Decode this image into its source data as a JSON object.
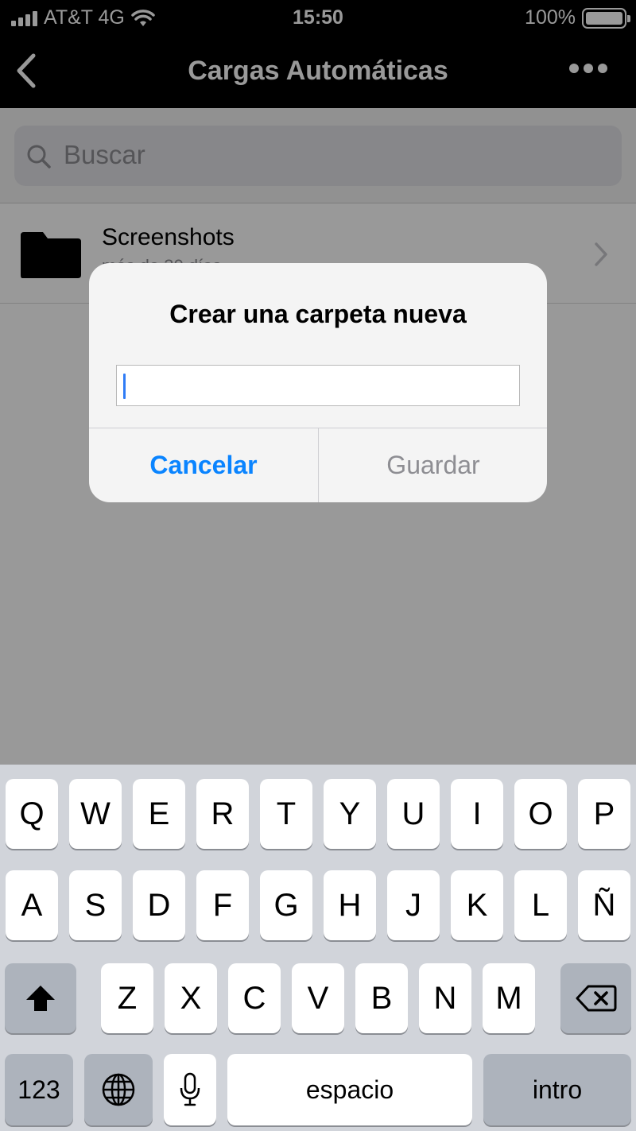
{
  "status_bar": {
    "carrier": "AT&T 4G",
    "time": "15:50",
    "battery": "100%",
    "battery_level": 1.0
  },
  "nav": {
    "title": "Cargas Automáticas",
    "back_icon": "chevron-left-icon",
    "more_icon": "ellipsis-icon"
  },
  "search": {
    "placeholder": "Buscar"
  },
  "list": {
    "items": [
      {
        "name": "Screenshots",
        "subtitle": "más de 30 días"
      }
    ]
  },
  "dialog": {
    "title": "Crear una carpeta nueva",
    "input_value": "",
    "cancel_label": "Cancelar",
    "save_label": "Guardar"
  },
  "keyboard": {
    "row1": [
      "Q",
      "W",
      "E",
      "R",
      "T",
      "Y",
      "U",
      "I",
      "O",
      "P"
    ],
    "row2": [
      "A",
      "S",
      "D",
      "F",
      "G",
      "H",
      "J",
      "K",
      "L",
      "Ñ"
    ],
    "row3": [
      "Z",
      "X",
      "C",
      "V",
      "B",
      "N",
      "M"
    ],
    "numbers_label": "123",
    "space_label": "espacio",
    "return_label": "intro"
  },
  "colors": {
    "accent": "#0a84ff",
    "disabled": "#8e8e93",
    "keyboard_bg": "#d1d4da"
  }
}
